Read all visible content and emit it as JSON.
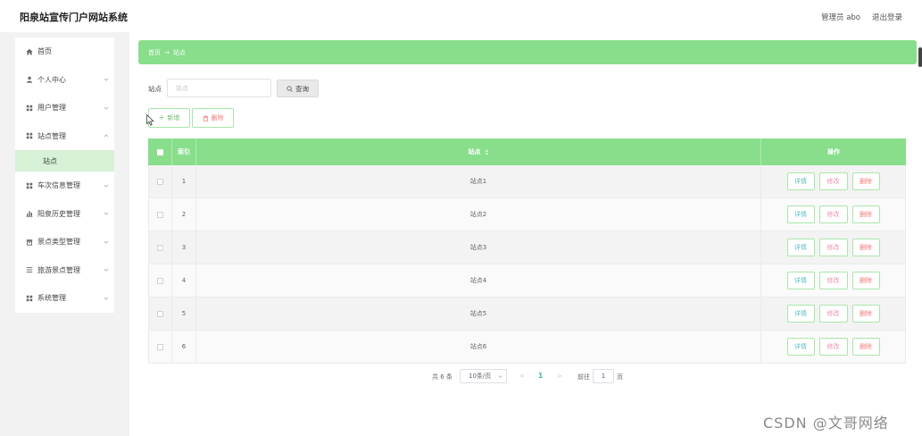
{
  "app": {
    "title": "阳泉站宣传门户网站系统"
  },
  "header": {
    "user_label": "管理员 abo",
    "logout_label": "退出登录"
  },
  "sidebar": {
    "items": [
      {
        "label": "首页",
        "icon": "home-icon"
      },
      {
        "label": "个人中心",
        "icon": "user-icon"
      },
      {
        "label": "用户管理",
        "icon": "grid-icon"
      },
      {
        "label": "站点管理",
        "icon": "grid-icon",
        "expanded": true,
        "children": [
          {
            "label": "站点",
            "active": true
          }
        ]
      },
      {
        "label": "车次信息管理",
        "icon": "grid-icon"
      },
      {
        "label": "阳泉历史管理",
        "icon": "bar-chart-icon"
      },
      {
        "label": "景点类型管理",
        "icon": "archive-icon"
      },
      {
        "label": "旅游景点管理",
        "icon": "list-icon"
      },
      {
        "label": "系统管理",
        "icon": "grid-icon"
      }
    ]
  },
  "breadcrumb": {
    "home": "首页",
    "separator": "→",
    "current": "站点"
  },
  "search": {
    "label": "站点",
    "placeholder": "站点",
    "value": "",
    "button_label": "查询"
  },
  "toolbar": {
    "add_label": "新增",
    "delete_label": "删除"
  },
  "table": {
    "columns": {
      "index": "索引",
      "station": "站点",
      "actions": "操作"
    },
    "rows": [
      {
        "index": "1",
        "station": "站点1"
      },
      {
        "index": "2",
        "station": "站点2"
      },
      {
        "index": "3",
        "station": "站点3"
      },
      {
        "index": "4",
        "station": "站点4"
      },
      {
        "index": "5",
        "station": "站点5"
      },
      {
        "index": "6",
        "station": "站点6"
      }
    ],
    "actions": {
      "detail": "详情",
      "edit": "修改",
      "delete": "删除"
    }
  },
  "pagination": {
    "total_text": "共 6 条",
    "page_size": "10条/页",
    "prev": "<",
    "current_page": "1",
    "next": ">",
    "goto_label": "前往",
    "goto_value": "1",
    "page_suffix": "页"
  },
  "watermark": "CSDN @文哥网络",
  "colors": {
    "accent": "#88de8b",
    "accent_border": "#a8e6aa",
    "active_submenu": "#d6f1d6",
    "detail_text": "#5bbcbc",
    "edit_text": "#e98fa8",
    "danger_text": "#f07a7a",
    "active_page": "#3cb8a6"
  }
}
